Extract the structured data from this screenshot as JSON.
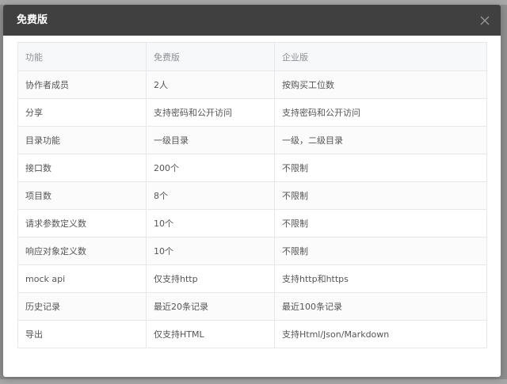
{
  "modal": {
    "title": "免费版"
  },
  "table": {
    "headers": [
      "功能",
      "免费版",
      "企业版"
    ],
    "rows": [
      [
        "协作者成员",
        "2人",
        "按购买工位数"
      ],
      [
        "分享",
        "支持密码和公开访问",
        "支持密码和公开访问"
      ],
      [
        "目录功能",
        "一级目录",
        "一级，二级目录"
      ],
      [
        "接口数",
        "200个",
        "不限制"
      ],
      [
        "项目数",
        "8个",
        "不限制"
      ],
      [
        "请求参数定义数",
        "10个",
        "不限制"
      ],
      [
        "响应对象定义数",
        "10个",
        "不限制"
      ],
      [
        "mock api",
        "仅支持http",
        "支持http和https"
      ],
      [
        "历史记录",
        "最近20条记录",
        "最近100条记录"
      ],
      [
        "导出",
        "仅支持HTML",
        "支持Html/Json/Markdown"
      ]
    ]
  },
  "icons": {
    "close": "close-icon"
  },
  "colors": {
    "header_bg": "#404040",
    "table_border": "#e6e8eb"
  }
}
